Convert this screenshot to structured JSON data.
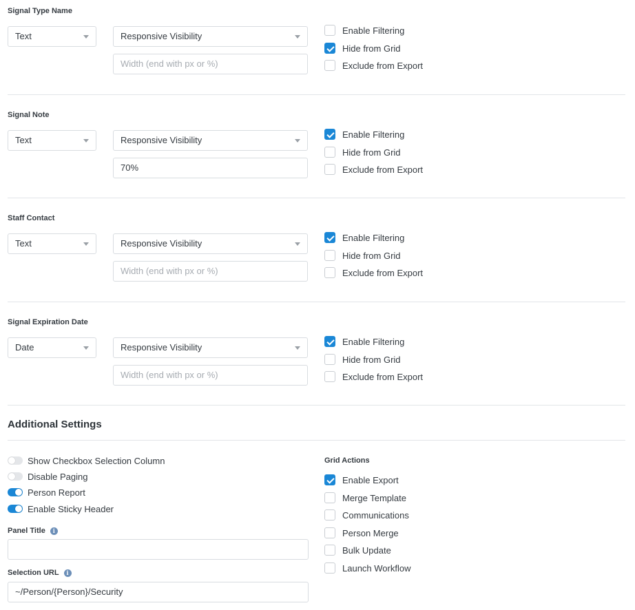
{
  "fields": [
    {
      "title": "Signal Type Name",
      "type": "Text",
      "visibility": "Responsive Visibility",
      "width_value": "",
      "width_placeholder": "Width (end with px or %)",
      "enable_filtering": false,
      "hide_from_grid": true,
      "exclude_from_export": false
    },
    {
      "title": "Signal Note",
      "type": "Text",
      "visibility": "Responsive Visibility",
      "width_value": "70%",
      "width_placeholder": "Width (end with px or %)",
      "enable_filtering": true,
      "hide_from_grid": false,
      "exclude_from_export": false
    },
    {
      "title": "Staff Contact",
      "type": "Text",
      "visibility": "Responsive Visibility",
      "width_value": "",
      "width_placeholder": "Width (end with px or %)",
      "enable_filtering": true,
      "hide_from_grid": false,
      "exclude_from_export": false
    },
    {
      "title": "Signal Expiration Date",
      "type": "Date",
      "visibility": "Responsive Visibility",
      "width_value": "",
      "width_placeholder": "Width (end with px or %)",
      "enable_filtering": true,
      "hide_from_grid": false,
      "exclude_from_export": false
    }
  ],
  "labels": {
    "enable_filtering": "Enable Filtering",
    "hide_from_grid": "Hide from Grid",
    "exclude_from_export": "Exclude from Export"
  },
  "additional": {
    "title": "Additional Settings",
    "toggles": [
      {
        "label": "Show Checkbox Selection Column",
        "on": false
      },
      {
        "label": "Disable Paging",
        "on": false
      },
      {
        "label": "Person Report",
        "on": true
      },
      {
        "label": "Enable Sticky Header",
        "on": true
      }
    ],
    "panel_title_label": "Panel Title",
    "panel_title_value": "",
    "selection_url_label": "Selection URL",
    "selection_url_value": "~/Person/{Person}/Security",
    "info_icon": "i",
    "grid_actions_title": "Grid Actions",
    "grid_actions": [
      {
        "label": "Enable Export",
        "checked": true
      },
      {
        "label": "Merge Template",
        "checked": false
      },
      {
        "label": "Communications",
        "checked": false
      },
      {
        "label": "Person Merge",
        "checked": false
      },
      {
        "label": "Bulk Update",
        "checked": false
      },
      {
        "label": "Launch Workflow",
        "checked": false
      }
    ]
  },
  "colors": {
    "accent": "#1a87d6",
    "border": "#d8dce0",
    "divider": "#e2e5e8"
  }
}
